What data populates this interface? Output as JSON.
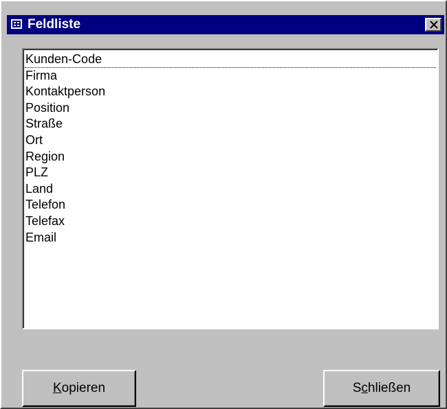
{
  "window": {
    "title": "Feldliste",
    "close_glyph": "✕"
  },
  "fields": {
    "items": [
      "Kunden-Code",
      "Firma",
      "Kontaktperson",
      "Position",
      "Straße",
      "Ort",
      "Region",
      "PLZ",
      "Land",
      "Telefon",
      "Telefax",
      "Email"
    ],
    "focused_index": 0
  },
  "buttons": {
    "copy": {
      "label": "Kopieren",
      "mnemonic": "K"
    },
    "close": {
      "label": "Schließen",
      "mnemonic": "c"
    }
  },
  "colors": {
    "titlebar": "#000080",
    "face": "#c0c0c0",
    "list_background": "#ffffff"
  },
  "icons": {
    "title": "field-list-icon",
    "close": "close-icon"
  }
}
